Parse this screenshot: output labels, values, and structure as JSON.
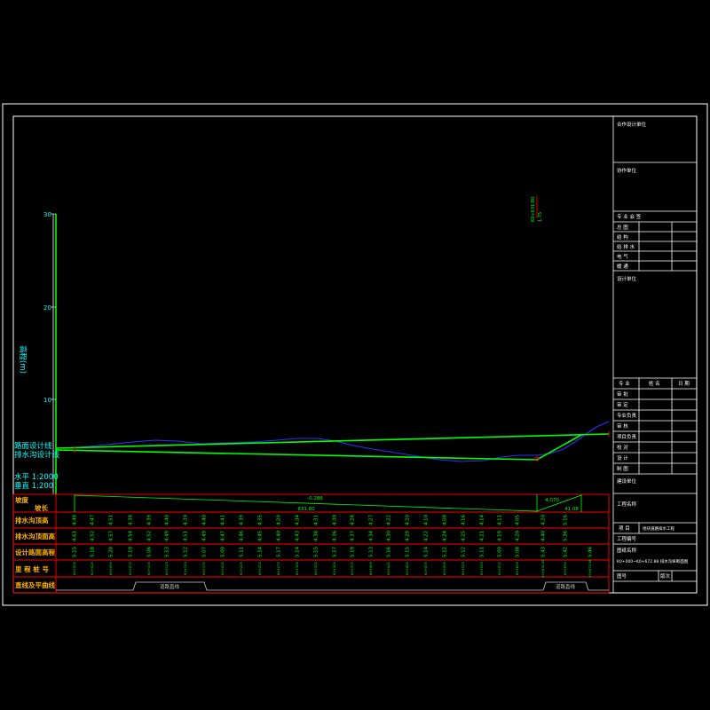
{
  "colors": {
    "background": "#000000",
    "frame": "#ffffff",
    "design_line": "#00ff00",
    "ground_line": "#3030ff",
    "table_grid": "#ff0000",
    "legend_text": "#00ffff",
    "row_label_text": "#ffb000",
    "value_text": "#00ff00",
    "alignment_line": "#c8c8c8"
  },
  "elevation_axis": {
    "label": "高程(m)",
    "ticks": [
      "30",
      "20",
      "10"
    ]
  },
  "legend": {
    "road_design_line": "路面设计线",
    "ditch_design_line": "排水沟设计线",
    "horizontal_scale": "水平 1:2000",
    "vertical_scale": "垂直 1:200"
  },
  "grade_change_point": {
    "station": "K0+631.80",
    "value": "1.75"
  },
  "table": {
    "slope_label": "坡度",
    "length_label": "坡长",
    "slopes": [
      {
        "grade": "-0.286",
        "length": "631.80"
      },
      {
        "grade": "4.070",
        "length": "41.08"
      }
    ],
    "rows": [
      {
        "label": "排水沟顶高",
        "values": [
          "4.48",
          "4.47",
          "4.51",
          "4.38",
          "4.39",
          "4.40",
          "4.39",
          "4.40",
          "4.41",
          "4.39",
          "4.35",
          "4.29",
          "4.34",
          "4.31",
          "4.30",
          "4.28",
          "4.27",
          "4.22",
          "4.20",
          "4.10",
          "4.08",
          "4.16",
          "4.14",
          "4.11",
          "4.05",
          "4.20",
          "5.16"
        ]
      },
      {
        "label": "排水沟顶面高",
        "values": [
          "4.61",
          "4.52",
          "4.57",
          "4.54",
          "4.52",
          "4.49",
          "4.51",
          "4.49",
          "4.47",
          "4.46",
          "4.45",
          "4.40",
          "4.43",
          "4.38",
          "4.36",
          "4.37",
          "4.34",
          "4.30",
          "4.29",
          "4.22",
          "4.24",
          "4.25",
          "4.21",
          "4.19",
          "4.20",
          "4.40",
          "5.36"
        ]
      },
      {
        "label": "设计路面高程",
        "values": [
          "5.15",
          "5.18",
          "5.20",
          "5.10",
          "5.06",
          "5.13",
          "5.12",
          "5.07",
          "5.09",
          "5.11",
          "5.14",
          "5.17",
          "5.14",
          "5.15",
          "5.17",
          "5.19",
          "5.13",
          "5.16",
          "5.15",
          "5.14",
          "5.12",
          "5.12",
          "5.11",
          "5.09",
          "5.08",
          "5.43",
          "5.42",
          "5.46"
        ]
      },
      {
        "label": "里 程 桩 号",
        "values": [
          "K0+000",
          "K0+025",
          "K0+050",
          "K0+075",
          "K0+100",
          "K0+125",
          "K0+150",
          "K0+175",
          "K0+200",
          "K0+225",
          "K0+250",
          "K0+275",
          "K0+300",
          "K0+325",
          "K0+350",
          "K0+375",
          "K0+400",
          "K0+425",
          "K0+450",
          "K0+475",
          "K0+500",
          "K0+525",
          "K0+550",
          "K0+575",
          "K0+600",
          "K0+631.80",
          "K0+650",
          "K0+672.88"
        ]
      }
    ],
    "alignment": {
      "label": "直线及平曲线",
      "segments": [
        "道路直线",
        "道路直线"
      ]
    }
  },
  "title_block": {
    "cooperating_designer": "合作设计单位",
    "collaborating_unit": "协作单位",
    "countersign": {
      "title": "专 业 会 签",
      "disciplines": [
        "总 图",
        "结 构",
        "给 排 水",
        "电 气",
        "暖 通"
      ]
    },
    "design_unit": "设计单位",
    "signatures": {
      "headers": [
        "专 业",
        "姓 名",
        "日 期"
      ],
      "roles": [
        "审 批",
        "审 定",
        "专业负责",
        "审 核",
        "项目负责",
        "校 对",
        "设 计",
        "制 图"
      ]
    },
    "client": "建设单位",
    "project_name_label": "工程名称",
    "project": {
      "label": "项 目",
      "value": "地块道路排水工程"
    },
    "project_number_label": "工程编号",
    "drawing_title_label": "图纸名称",
    "drawing_title": "K0+000~K0+672.88 排水沟纵断面图",
    "drawing_number_label": "图号",
    "revision_label": "版次"
  }
}
